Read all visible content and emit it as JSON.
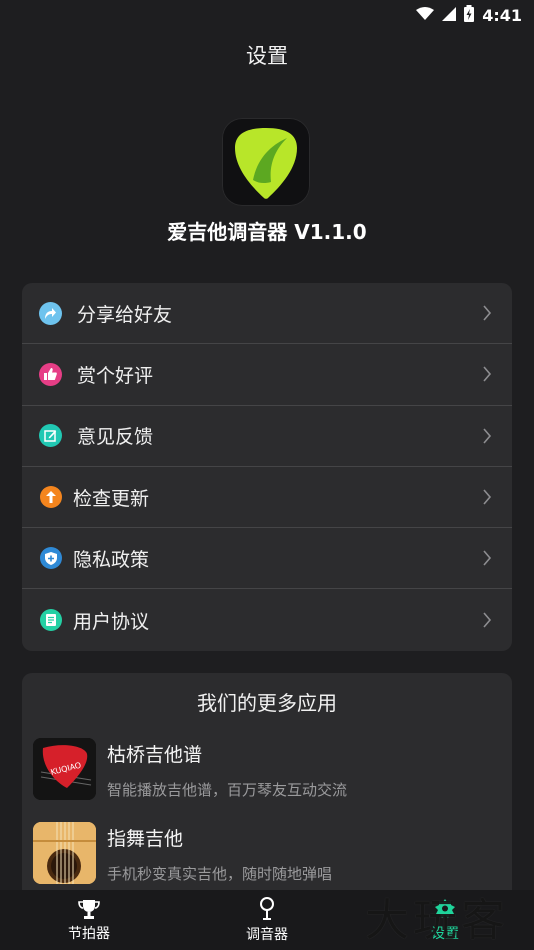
{
  "status_bar": {
    "time": "4:41",
    "icons": [
      "wifi-icon",
      "signal-icon",
      "battery-charging-icon"
    ]
  },
  "header": {
    "title": "设置"
  },
  "app": {
    "name": "爱吉他调音器 V1.1.0",
    "logo_icon": "guitar-pick-logo"
  },
  "menu": {
    "items": [
      {
        "label": "分享给好友",
        "icon": "share-icon",
        "color": "#6ec3ee"
      },
      {
        "label": "赏个好评",
        "icon": "thumbs-up-icon",
        "color": "#e63e86"
      },
      {
        "label": "意见反馈",
        "icon": "feedback-edit-icon",
        "color": "#21c8b3"
      },
      {
        "label": "检查更新",
        "icon": "update-arrow-icon",
        "color": "#f4851e"
      },
      {
        "label": "隐私政策",
        "icon": "privacy-shield-icon",
        "color": "#2f8ad6"
      },
      {
        "label": "用户协议",
        "icon": "agreement-doc-icon",
        "color": "#24d0a4"
      }
    ]
  },
  "more_apps": {
    "title": "我们的更多应用",
    "apps": [
      {
        "name": "枯桥吉他谱",
        "desc": "智能播放吉他谱，百万琴友互动交流",
        "thumb_text": "KUQIAO"
      },
      {
        "name": "指舞吉他",
        "desc": "手机秒变真实吉他，随时随地弹唱"
      }
    ]
  },
  "bottom_nav": {
    "items": [
      {
        "label": "节拍器",
        "icon": "trophy-icon"
      },
      {
        "label": "调音器",
        "icon": "tuning-pin-icon"
      },
      {
        "label": "设置",
        "icon": "settings-icon",
        "active": true
      }
    ]
  },
  "watermark": "大玩客",
  "colors": {
    "background": "#1e1e20",
    "card": "#2c2c2e",
    "accent": "#1ed39a",
    "logo": "#b8e629"
  }
}
